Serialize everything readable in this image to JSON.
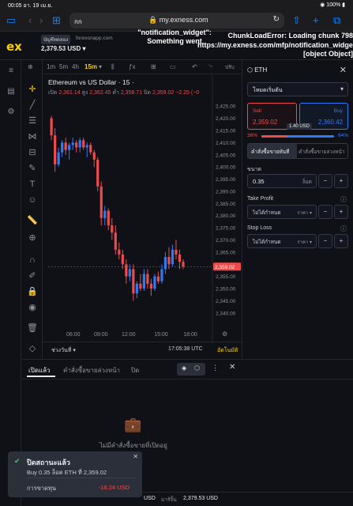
{
  "status": {
    "time": "00:05",
    "date": "อา. 19 เม.ย.",
    "battery": "100%"
  },
  "browser": {
    "text_size": "กก",
    "url": "my.exness.com",
    "reload_icon": "reload-icon"
  },
  "header": {
    "account_badge": "บัญชีทดลอง",
    "server": "forexonapp.com",
    "balance": "2,379.53 USD",
    "error_center": "\"notification_widget\": Something went",
    "error_right_1": "ChunkLoadError: Loading chunk 798",
    "error_right_2": "https://my.exness.com/mfp/notification_widget",
    "error_right_3": "[object Object]"
  },
  "chart_toolbar": {
    "timeframes": [
      "1m",
      "5m",
      "4h",
      "15m"
    ],
    "active_tf": "15m",
    "publish": "ปรับ"
  },
  "chart_data": {
    "type": "candlestick",
    "title": "Ethereum vs US Dollar · 15 ·",
    "ohlc": {
      "open_label": "เปิด",
      "open": "2,361.14",
      "high_label": "สูง",
      "high": "2,362.45",
      "low_label": "ต่ำ",
      "low": "2,358.71",
      "close_label": "ปิด",
      "close": "2,359.02",
      "change": "−2.25 (−0"
    },
    "y_ticks": [
      "2,425.00",
      "2,420.00",
      "2,415.00",
      "2,410.00",
      "2,405.00",
      "2,400.00",
      "2,395.00",
      "2,390.00",
      "2,385.00",
      "2,380.00",
      "2,375.00",
      "2,370.00",
      "2,365.00",
      "2,360.00",
      "2,355.00",
      "2,350.00",
      "2,345.00",
      "2,340.00"
    ],
    "y_values": [
      2425,
      2420,
      2415,
      2410,
      2405,
      2400,
      2395,
      2390,
      2385,
      2380,
      2375,
      2370,
      2365,
      2360,
      2355,
      2350,
      2345,
      2340
    ],
    "x_ticks": [
      "06:00",
      "09:00",
      "12:00",
      "15:00",
      "18:00"
    ],
    "ylim": [
      2337,
      2428
    ],
    "last_price": "2,359.02",
    "last_value": 2359.02,
    "candles": [
      [
        2420,
        2421,
        2411,
        2413
      ],
      [
        2413,
        2416,
        2398,
        2401
      ],
      [
        2401,
        2408,
        2400,
        2406
      ],
      [
        2406,
        2411,
        2404,
        2410
      ],
      [
        2410,
        2412,
        2405,
        2407
      ],
      [
        2407,
        2410,
        2403,
        2409
      ],
      [
        2409,
        2412,
        2407,
        2410
      ],
      [
        2410,
        2411,
        2406,
        2408
      ],
      [
        2408,
        2412,
        2406,
        2411
      ],
      [
        2411,
        2412,
        2407,
        2408
      ],
      [
        2408,
        2410,
        2404,
        2409
      ],
      [
        2409,
        2410,
        2405,
        2406
      ],
      [
        2406,
        2407,
        2400,
        2403
      ],
      [
        2403,
        2404,
        2390,
        2392
      ],
      [
        2392,
        2394,
        2376,
        2379
      ],
      [
        2379,
        2384,
        2376,
        2382
      ],
      [
        2382,
        2383,
        2374,
        2376
      ],
      [
        2376,
        2379,
        2370,
        2373
      ],
      [
        2373,
        2376,
        2364,
        2366
      ],
      [
        2366,
        2369,
        2362,
        2364
      ],
      [
        2364,
        2366,
        2358,
        2360
      ],
      [
        2360,
        2362,
        2352,
        2355
      ],
      [
        2355,
        2360,
        2353,
        2358
      ],
      [
        2358,
        2360,
        2345,
        2348
      ],
      [
        2348,
        2353,
        2346,
        2352
      ],
      [
        2352,
        2356,
        2349,
        2350
      ],
      [
        2350,
        2358,
        2349,
        2356
      ],
      [
        2356,
        2358,
        2350,
        2352
      ],
      [
        2352,
        2354,
        2347,
        2350
      ],
      [
        2350,
        2356,
        2349,
        2355
      ],
      [
        2355,
        2357,
        2352,
        2353
      ],
      [
        2353,
        2360,
        2352,
        2358
      ],
      [
        2358,
        2365,
        2356,
        2363
      ],
      [
        2363,
        2367,
        2358,
        2360
      ],
      [
        2360,
        2368,
        2359,
        2366
      ],
      [
        2366,
        2370,
        2362,
        2364
      ],
      [
        2364,
        2366,
        2358,
        2361
      ],
      [
        2361,
        2362,
        2358,
        2359
      ]
    ]
  },
  "chart_bottom": {
    "range": "ช่วงวันที่",
    "time": "17:05:38 UTC",
    "auto": "อัตโนมัติ"
  },
  "panel": {
    "symbol": "ETH",
    "order_type": "โหมดเริ่มต้น",
    "sell_label": "Sell",
    "sell_price": "2,359.02",
    "buy_label": "Buy",
    "buy_price": "2,360.42",
    "spread": "1.40 USD",
    "sell_pct": "36%",
    "buy_pct": "64%",
    "sell_pct_value": 36,
    "tab_market": "คำสั่งซื้อขายทันที",
    "tab_pending": "คำสั่งซื้อขายล่วงหน้า",
    "volume_label": "ขนาด",
    "volume_value": "0.35",
    "volume_unit": "ล็อต",
    "tp_label": "Take Profit",
    "tp_value": "ไม่ได้กำหนด",
    "tp_unit": "ราคา",
    "sl_label": "Stop Loss",
    "sl_value": "ไม่ได้กำหนด",
    "sl_unit": "ราคา"
  },
  "orders": {
    "tab_open": "เปิดแล้ว",
    "tab_pending": "คำสั่งซื้อขายล่วงหน้า",
    "tab_closed": "ปิด",
    "empty": "ไม่มีคำสั่งซื้อขายที่เปิดอยู่"
  },
  "toast": {
    "title": "ปิดสถานะแล้ว",
    "detail": "Buy 0.35 ล็อต ETH ที่ 2,359.02",
    "loss_label": "การขาดทุน",
    "loss_value": "-18.24 USD"
  },
  "footer": {
    "left": "USD",
    "margin_label": "มาร์จิ้น",
    "margin_value": "2,379.53 USD"
  },
  "colors": {
    "accent": "#ffcf01",
    "sell": "#ef4b4b",
    "buy": "#2f7bf6",
    "bg": "#0f1117"
  }
}
